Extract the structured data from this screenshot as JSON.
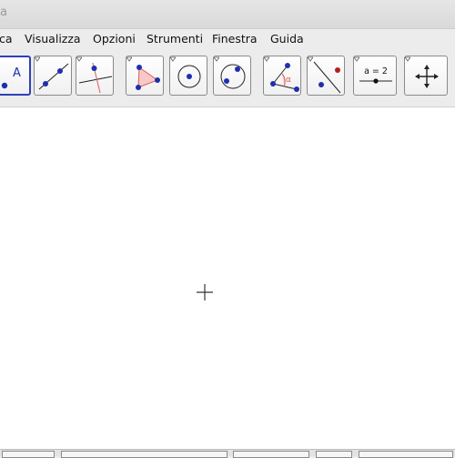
{
  "window": {
    "title_fragment": "a"
  },
  "menu": {
    "items": [
      {
        "label": "ca"
      },
      {
        "label": "Visualizza"
      },
      {
        "label": "Opzioni"
      },
      {
        "label": "Strumenti"
      },
      {
        "label": "Finestra"
      },
      {
        "label": "Guida"
      }
    ]
  },
  "toolbar": {
    "tools": [
      {
        "icon": "new-point-icon",
        "selected": true
      },
      {
        "icon": "line-through-two-points-icon"
      },
      {
        "icon": "perpendicular-line-icon"
      },
      {
        "icon": "polygon-icon"
      },
      {
        "icon": "circle-with-center-icon"
      },
      {
        "icon": "circle-through-three-points-icon"
      },
      {
        "icon": "angle-icon"
      },
      {
        "icon": "reflect-about-line-icon"
      },
      {
        "icon": "slider-icon",
        "label": "a = 2"
      },
      {
        "icon": "move-graphics-view-icon"
      }
    ]
  },
  "colors": {
    "point": "#1e2fb0",
    "accent_red": "#e05a5a",
    "selected_border": "#2f3fb8",
    "canvas": "#ffffff"
  }
}
